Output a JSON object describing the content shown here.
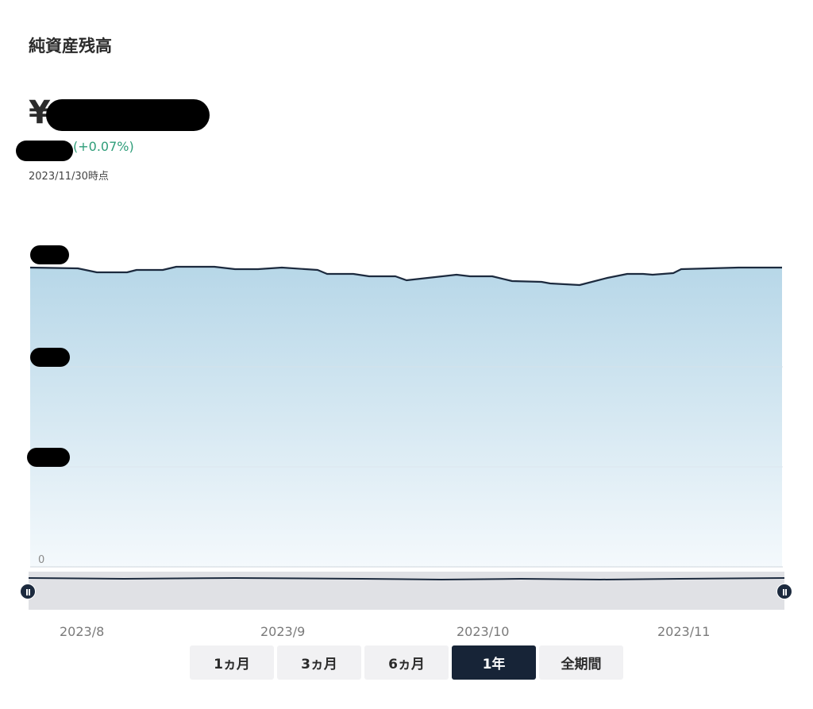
{
  "header": {
    "title": "純資産残高",
    "currency_symbol": "¥",
    "change_percent": "(+0.07%)",
    "as_of": "2023/11/30時点"
  },
  "colors": {
    "line": "#1c2a3e",
    "area_top": "#b7d7e8",
    "area_bottom": "#f4f9fc",
    "change_positive": "#2e9d79",
    "active_tab": "#172437"
  },
  "chart_data": {
    "type": "area",
    "x": [
      "2023/7/26",
      "2023/8",
      "2023/8/15",
      "2023/9",
      "2023/9/20",
      "2023/10",
      "2023/10/18",
      "2023/11",
      "2023/11/14"
    ],
    "x_tick_labels": [
      "2023/8",
      "2023/9",
      "2023/10",
      "2023/11"
    ],
    "y_tick_labels": [
      "0"
    ],
    "series_relative": [
      0.998,
      0.98,
      0.996,
      0.992,
      0.97,
      0.975,
      0.958,
      0.983,
      0.998
    ],
    "grid": "horizontal"
  },
  "range_tabs": [
    {
      "label": "1ヵ月",
      "active": false
    },
    {
      "label": "3ヵ月",
      "active": false
    },
    {
      "label": "6ヵ月",
      "active": false
    },
    {
      "label": "1年",
      "active": true
    },
    {
      "label": "全期間",
      "active": false
    }
  ]
}
